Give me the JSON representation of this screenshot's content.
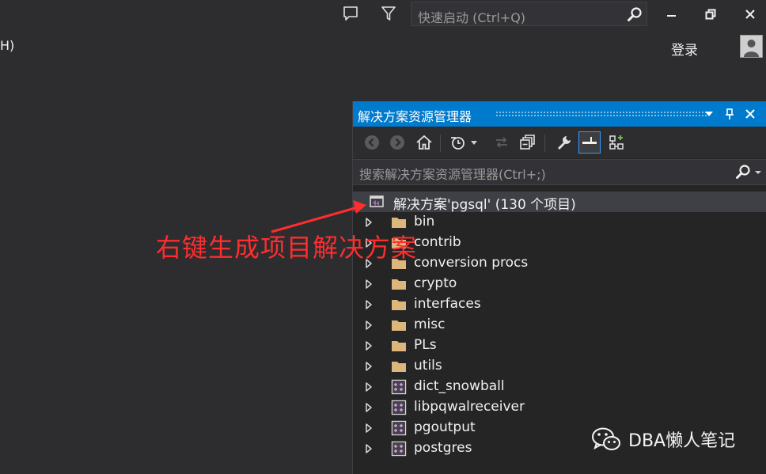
{
  "titlebar": {
    "quick_launch_placeholder": "快速启动 (Ctrl+Q)",
    "menu_fragment": "H)",
    "login_label": "登录"
  },
  "solution_explorer": {
    "title": "解决方案资源管理器",
    "search_placeholder": "搜索解决方案资源管理器(Ctrl+;)",
    "solution_label": "解决方案'pgsql' (130 个项目)",
    "items": [
      {
        "label": "bin",
        "type": "folder"
      },
      {
        "label": "contrib",
        "type": "folder"
      },
      {
        "label": "conversion procs",
        "type": "folder"
      },
      {
        "label": "crypto",
        "type": "folder"
      },
      {
        "label": "interfaces",
        "type": "folder"
      },
      {
        "label": "misc",
        "type": "folder"
      },
      {
        "label": "PLs",
        "type": "folder"
      },
      {
        "label": "utils",
        "type": "folder"
      },
      {
        "label": "dict_snowball",
        "type": "project"
      },
      {
        "label": "libpqwalreceiver",
        "type": "project"
      },
      {
        "label": "pgoutput",
        "type": "project"
      },
      {
        "label": "postgres",
        "type": "project"
      }
    ]
  },
  "annotation": {
    "text": "右键生成项目解决方案",
    "color": "#ff2d2d"
  },
  "watermark": {
    "text": "DBA懒人笔记"
  },
  "colors": {
    "accent": "#007acc",
    "background": "#2d2d30",
    "panel": "#252526",
    "folder": "#dcb67a",
    "project": "#9b6bb3"
  }
}
